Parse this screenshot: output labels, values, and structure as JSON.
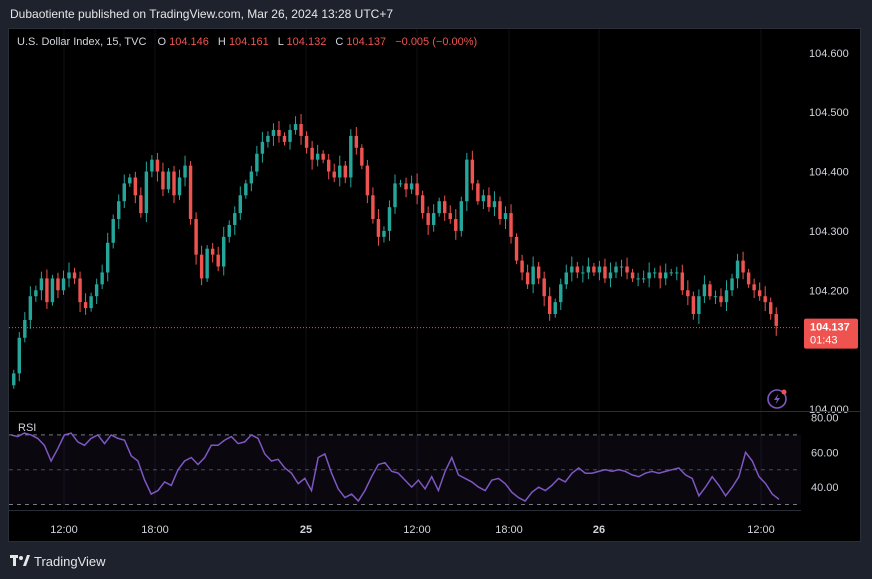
{
  "header": {
    "publish_text": "Dubaotiente published on TradingView.com, Mar 26, 2024 13:28 UTC+7"
  },
  "legend": {
    "symbol": "U.S. Dollar Index, 15, TVC",
    "o_label": "O",
    "o_value": "104.146",
    "h_label": "H",
    "h_value": "104.161",
    "l_label": "L",
    "l_value": "104.132",
    "c_label": "C",
    "c_value": "104.137",
    "change": "−0.005 (−0.00%)"
  },
  "price_axis": {
    "ticks": [
      "104.600",
      "104.500",
      "104.400",
      "104.300",
      "104.200",
      "104.000"
    ]
  },
  "last_price_label": {
    "price": "104.137",
    "countdown": "01:43"
  },
  "rsi_panel": {
    "label": "RSI",
    "ticks": [
      "80.00",
      "60.00",
      "40.00"
    ]
  },
  "time_axis": {
    "labels": [
      "12:00",
      "18:00",
      "25",
      "12:00",
      "18:00",
      "26",
      "12:00"
    ]
  },
  "footer": {
    "brand": "TradingView"
  },
  "colors": {
    "up": "#26a69a",
    "down": "#ef5350",
    "rsi_line": "#7e57c2",
    "background": "#000000",
    "frame": "#1e222d"
  },
  "icons": {
    "alert": "lightning-icon",
    "logo": "tradingview-logo-icon"
  },
  "chart_data": [
    {
      "type": "candlestick",
      "title": "U.S. Dollar Index, 15, TVC",
      "ylim": [
        104.0,
        104.63
      ],
      "close_series": [
        104.06,
        104.12,
        104.15,
        104.19,
        104.2,
        104.22,
        104.18,
        104.22,
        104.2,
        104.22,
        104.23,
        104.22,
        104.18,
        104.17,
        104.19,
        104.21,
        104.23,
        104.28,
        104.32,
        104.35,
        104.38,
        104.39,
        104.36,
        104.33,
        104.4,
        104.42,
        104.4,
        104.37,
        104.4,
        104.36,
        104.39,
        104.41,
        104.32,
        104.26,
        104.22,
        104.27,
        104.26,
        104.24,
        104.29,
        104.31,
        104.33,
        104.36,
        104.38,
        104.4,
        104.43,
        104.45,
        104.46,
        104.47,
        104.46,
        104.45,
        104.47,
        104.48,
        104.46,
        104.44,
        104.42,
        104.43,
        104.42,
        104.4,
        104.39,
        104.41,
        104.39,
        104.46,
        104.44,
        104.41,
        104.36,
        104.32,
        104.29,
        104.3,
        104.34,
        104.38,
        104.38,
        104.37,
        104.38,
        104.36,
        104.33,
        104.31,
        104.33,
        104.35,
        104.33,
        104.32,
        104.3,
        104.35,
        104.42,
        104.38,
        104.35,
        104.36,
        104.34,
        104.35,
        104.32,
        104.33,
        104.29,
        104.25,
        104.23,
        104.21,
        104.24,
        104.22,
        104.19,
        104.16,
        104.18,
        104.21,
        104.23,
        104.24,
        104.23,
        104.23,
        104.24,
        104.23,
        104.24,
        104.22,
        104.23,
        104.24,
        104.24,
        104.23,
        104.22,
        104.22,
        104.22,
        104.23,
        104.23,
        104.22,
        104.23,
        104.23,
        104.23,
        104.2,
        104.19,
        104.16,
        104.19,
        104.21,
        104.19,
        104.19,
        104.18,
        104.2,
        104.22,
        104.25,
        104.23,
        104.21,
        104.2,
        104.19,
        104.18,
        104.16,
        104.14
      ]
    },
    {
      "type": "line",
      "title": "RSI",
      "ylim": [
        28,
        82
      ],
      "series": [
        {
          "name": "RSI",
          "values": [
            70,
            69,
            71,
            70,
            68,
            64,
            55,
            62,
            70,
            71,
            66,
            64,
            68,
            70,
            65,
            70,
            68,
            67,
            58,
            55,
            44,
            36,
            38,
            43,
            41,
            50,
            55,
            57,
            53,
            57,
            64,
            64,
            67,
            69,
            65,
            66,
            70,
            68,
            59,
            55,
            56,
            51,
            48,
            42,
            45,
            38,
            57,
            59,
            48,
            39,
            34,
            36,
            32,
            38,
            46,
            53,
            54,
            49,
            48,
            44,
            40,
            44,
            39,
            46,
            38,
            49,
            57,
            47,
            45,
            43,
            40,
            38,
            44,
            45,
            42,
            37,
            34,
            32,
            37,
            40,
            38,
            41,
            45,
            43,
            48,
            51,
            48,
            48,
            49,
            50,
            49,
            50,
            49,
            47,
            46,
            48,
            49,
            48,
            49,
            50,
            51,
            47,
            45,
            35,
            40,
            46,
            41,
            35,
            40,
            46,
            60,
            55,
            46,
            42,
            36,
            33
          ]
        }
      ],
      "reference_lines": [
        70,
        50,
        30
      ]
    }
  ]
}
